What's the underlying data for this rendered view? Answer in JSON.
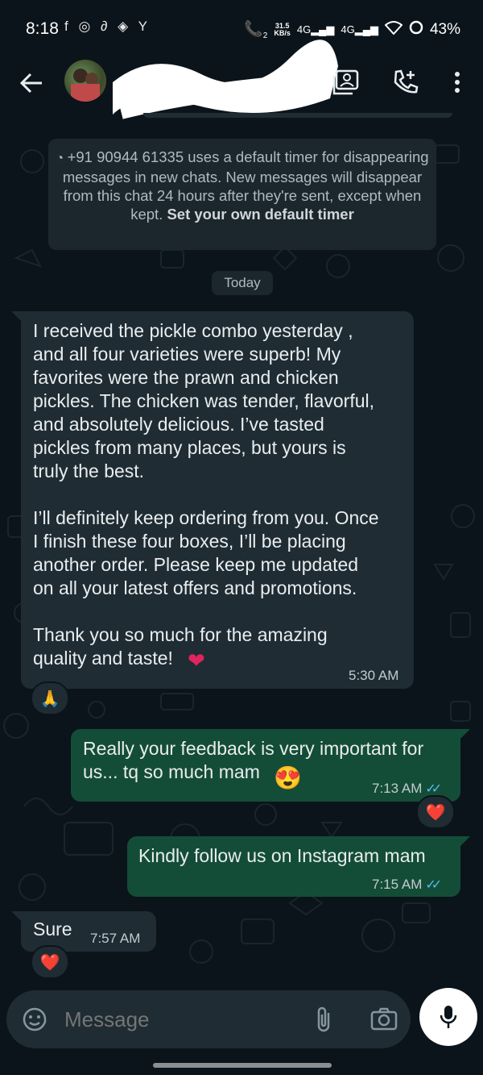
{
  "status_bar": {
    "time": "8:18",
    "app_icons": "f ◎ ∂ ◈ Y",
    "speed_value": "31.5",
    "speed_unit": "KB/s",
    "network_label_1": "4G",
    "network_label_2": "4G",
    "call_sim": "2",
    "battery": "43%"
  },
  "header": {
    "contact_name": "",
    "icons": [
      "back-arrow-icon",
      "gallery-icon",
      "add-call-icon",
      "more-vert-icon"
    ]
  },
  "system_note": {
    "text": "+91 90944 61335 uses a default timer for disappearing messages in new chats. New messages will disappear from this chat 24 hours after they're sent, except when kept.",
    "link": "Set your own default timer"
  },
  "date_chip": "Today",
  "messages": [
    {
      "direction": "in",
      "text": "I received the pickle combo yesterday ,\nand all four varieties were superb! My\nfavorites were the prawn and chicken\npickles. The chicken was tender, flavorful,\nand absolutely delicious. I’ve tasted\npickles from many places, but yours is\ntruly the best.\n\nI’ll definitely keep ordering from you. Once\nI finish these four boxes, I’ll be placing\nanother order. Please keep me updated\non all your latest offers and promotions.\n\nThank you so much for the amazing\nquality and taste!",
      "emoji": "❤️",
      "time": "5:30 AM",
      "reaction": "🙏"
    },
    {
      "direction": "out",
      "text": "Really your feedback is very important for\nus... tq so much mam",
      "emoji": "😍",
      "time": "7:13 AM",
      "ticks": "✓✓",
      "reaction": "❤️"
    },
    {
      "direction": "out",
      "text": "Kindly follow us on Instagram mam",
      "time": "7:15 AM",
      "ticks": "✓✓"
    },
    {
      "direction": "in",
      "text": "Sure",
      "time": "7:57 AM",
      "reaction": "❤️"
    }
  ],
  "composer": {
    "placeholder": "Message",
    "icons": [
      "emoji-sticker-icon",
      "attach-icon",
      "camera-icon",
      "mic-icon"
    ]
  },
  "colors": {
    "background": "#0b141a",
    "incoming_bubble": "#1f2c33",
    "outgoing_bubble": "#144d37",
    "read_ticks": "#53bdeb"
  }
}
